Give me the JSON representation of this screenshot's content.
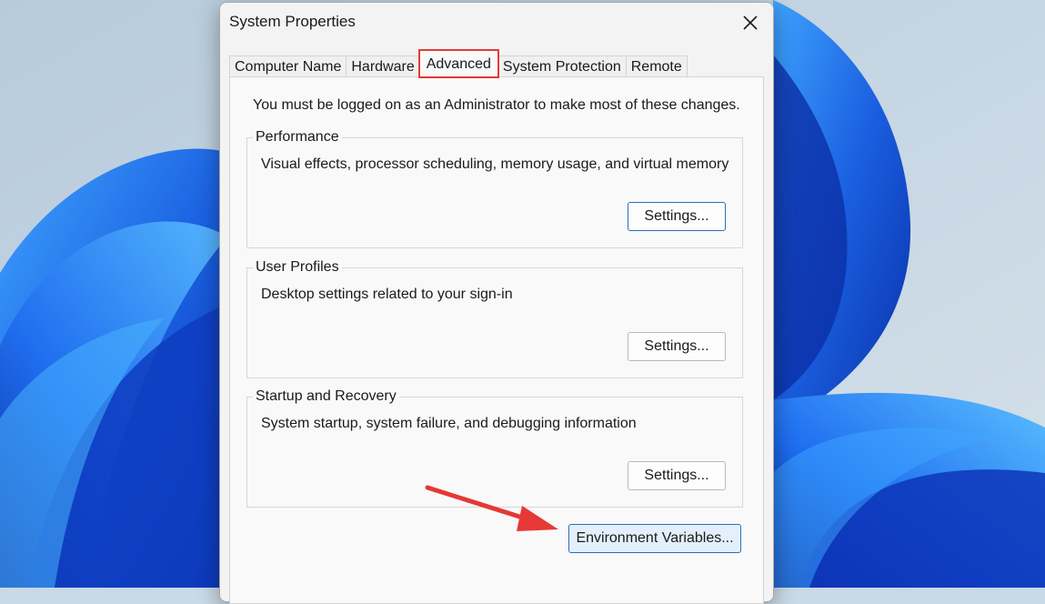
{
  "window": {
    "title": "System Properties",
    "close_glyph": "✕"
  },
  "tabs": [
    {
      "label": "Computer Name",
      "active": false
    },
    {
      "label": "Hardware",
      "active": false
    },
    {
      "label": "Advanced",
      "active": true
    },
    {
      "label": "System Protection",
      "active": false
    },
    {
      "label": "Remote",
      "active": false
    }
  ],
  "advanced": {
    "admin_note": "You must be logged on as an Administrator to make most of these changes.",
    "performance": {
      "legend": "Performance",
      "description": "Visual effects, processor scheduling, memory usage, and virtual memory",
      "button": "Settings..."
    },
    "user_profiles": {
      "legend": "User Profiles",
      "description": "Desktop settings related to your sign-in",
      "button": "Settings..."
    },
    "startup_recovery": {
      "legend": "Startup and Recovery",
      "description": "System startup, system failure, and debugging information",
      "button": "Settings..."
    },
    "env_button": "Environment Variables..."
  },
  "colors": {
    "highlight_red": "#e53935",
    "focus_blue": "#2b6fb5",
    "wallpaper_blue": "#1a5fe0"
  },
  "icons": {
    "close": "close-icon",
    "annotation": "red-arrow-icon"
  }
}
